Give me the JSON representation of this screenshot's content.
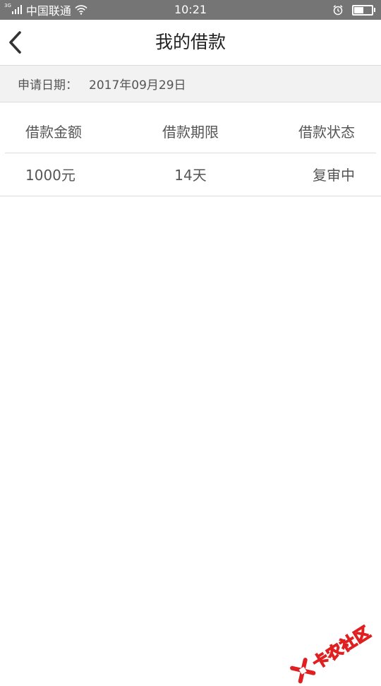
{
  "status_bar": {
    "network": "3G",
    "carrier": "中国联通",
    "time": "10:21",
    "battery_level": 0.55,
    "icons": [
      "signal-icon",
      "wifi-icon",
      "alarm-icon",
      "battery-icon"
    ]
  },
  "header": {
    "back_icon": "chevron-left-icon",
    "title": "我的借款"
  },
  "application": {
    "date_label": "申请日期：",
    "date_value": "2017年09月29日"
  },
  "table": {
    "columns": [
      "借款金额",
      "借款期限",
      "借款状态"
    ],
    "rows": [
      [
        "1000元",
        "14天",
        "复审中"
      ]
    ]
  },
  "watermark": {
    "text": "卡农社区",
    "color": "#e02020"
  },
  "colors": {
    "status_bar": "#757575",
    "date_bar": "#f2f2f2",
    "divider": "#dcdcdc",
    "text": "#555555"
  }
}
